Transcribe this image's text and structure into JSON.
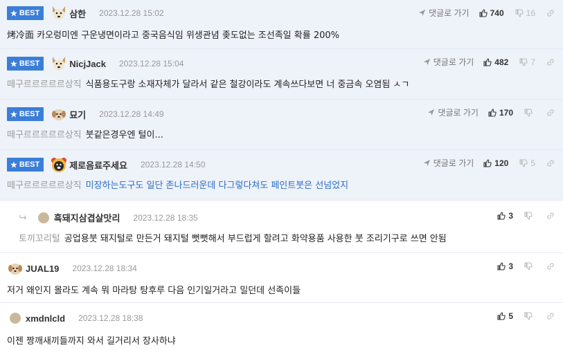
{
  "common": {
    "best_label": "BEST",
    "reply_label": "댓글로 가기"
  },
  "comments": [
    {
      "best": true,
      "nick": "삼한",
      "date": "2023.12.28 15:02",
      "up": "740",
      "down": "16",
      "prefix": "",
      "text": "烤冷面 카오렁미엔 구운냉면이라고 중국음식임 위생관념 좆도없는 조선족일 확률 200%"
    },
    {
      "best": true,
      "nick": "NicjJack",
      "date": "2023.12.28 15:04",
      "up": "482",
      "down": "7",
      "prefix": "떼구르르르르르상직",
      "text": "식품용도구랑 소재자체가 달라서 같은 철강이라도 계속쓰다보면 너 중금속 오염됨 ㅅㄱ"
    },
    {
      "best": true,
      "nick": "묘기",
      "date": "2023.12.28 14:49",
      "up": "170",
      "down": "",
      "prefix": "떼구르르르르르상직",
      "text": "붓같은경우엔 털이..."
    },
    {
      "best": true,
      "nick": "제로음료주세요",
      "date": "2023.12.28 14:50",
      "up": "120",
      "down": "5",
      "prefix": "떼구르르르르르상직",
      "text": "미장하는도구도 일단 존나드러운데 다그렇다쳐도 페인트붓은 선넘었지"
    },
    {
      "best": false,
      "nick": "흑돼지삼겹살맛리",
      "date": "2023.12.28 18:35",
      "up": "3",
      "down": "",
      "prefix": "토끼꼬리털",
      "text": "공업용붓 돼지털로 만든거 돼지털 뻣뻣해서 부드럽게 할려고 화약용품 사용한 붓 조리기구로 쓰면 안됨"
    },
    {
      "best": false,
      "nick": "JUAL19",
      "date": "2023.12.28 18:34",
      "up": "3",
      "down": "",
      "prefix": "",
      "text": "저거 왜인지 몰라도 계속 뭐 마라탕 탕후루 다음 인기일거라고 밀던데 선족이들"
    },
    {
      "best": false,
      "nick": "xmdnlcld",
      "date": "2023.12.28 18:38",
      "up": "5",
      "down": "",
      "prefix": "",
      "text": "이젠 짱깨새끼들까지 와서 길거리서 장사하냐"
    }
  ]
}
